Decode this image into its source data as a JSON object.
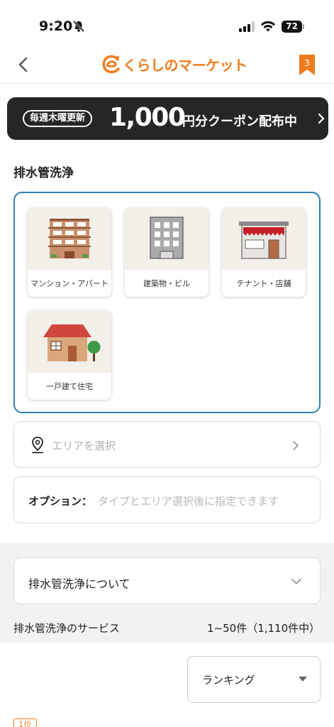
{
  "status": {
    "time": "9:20",
    "battery": "72"
  },
  "header": {
    "logo_text": "くらしのマーケット",
    "bookmark_count": "3"
  },
  "banner": {
    "pill": "毎週木曜更新",
    "amount": "1,000",
    "text": "円分クーポン配布中"
  },
  "section": {
    "title": "排水管洗浄"
  },
  "property_types": [
    {
      "label": "マンション・アパート",
      "icon": "apartment-building-icon"
    },
    {
      "label": "建築物・ビル",
      "icon": "office-building-icon"
    },
    {
      "label": "テナント・店舗",
      "icon": "storefront-icon"
    },
    {
      "label": "一戸建て住宅",
      "icon": "house-icon"
    }
  ],
  "area": {
    "placeholder": "エリアを選択"
  },
  "option": {
    "label": "オプション：",
    "note": "タイプとエリア選択後に指定できます"
  },
  "about": {
    "label": "排水管洗浄について"
  },
  "service": {
    "label": "排水管洗浄のサービス",
    "count": "1~50件（1,110件中）"
  },
  "sort": {
    "selected": "ランキング"
  },
  "rank_badge": "1位",
  "colors": {
    "brand_orange": "#ef7c1c",
    "selected_border": "#2d7fb5",
    "banner_bg": "#262626"
  }
}
